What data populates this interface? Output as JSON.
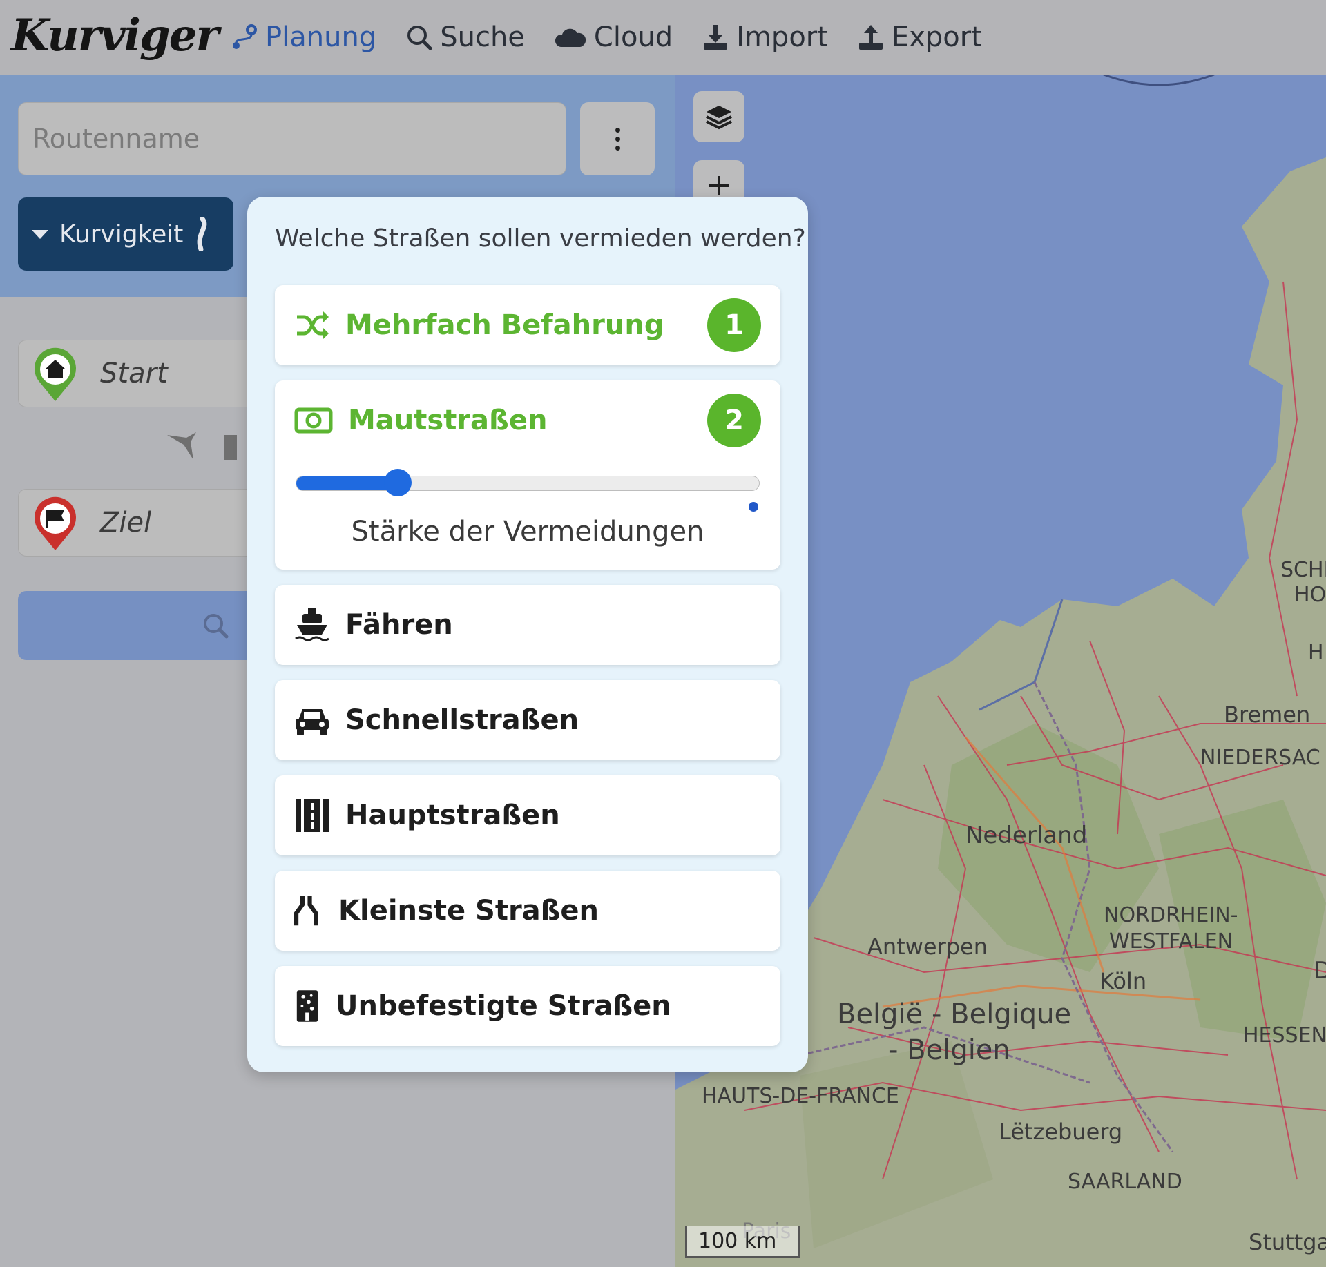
{
  "app": {
    "logo_text": "Kurviger"
  },
  "nav": {
    "items": [
      {
        "label": "Planung",
        "icon": "route-icon",
        "active": true
      },
      {
        "label": "Suche",
        "icon": "search-icon"
      },
      {
        "label": "Cloud",
        "icon": "cloud-icon"
      },
      {
        "label": "Import",
        "icon": "download-icon"
      },
      {
        "label": "Export",
        "icon": "upload-icon"
      }
    ]
  },
  "panel": {
    "routename_placeholder": "Routenname",
    "curviness_label": "Kurvigkeit",
    "start_placeholder": "Start",
    "destination_placeholder": "Ziel"
  },
  "avoid_popup": {
    "title": "Welche Straßen sollen vermieden werden?",
    "options": [
      {
        "label": "Mehrfach Befahrung",
        "icon": "shuffle-icon",
        "selected": true,
        "badge": "1"
      },
      {
        "label": "Mautstraßen",
        "icon": "money-bill-icon",
        "selected": true,
        "badge": "2",
        "strength_label": "Stärke der Vermeidungen",
        "strength_fraction": 0.22
      },
      {
        "label": "Fähren",
        "icon": "ferry-icon",
        "selected": false
      },
      {
        "label": "Schnellstraßen",
        "icon": "car-icon",
        "selected": false
      },
      {
        "label": "Hauptstraßen",
        "icon": "road-icon",
        "selected": false
      },
      {
        "label": "Kleinste Straßen",
        "icon": "narrow-road-icon",
        "selected": false
      },
      {
        "label": "Unbefestigte Straßen",
        "icon": "dirt-road-icon",
        "selected": false
      }
    ]
  },
  "map": {
    "scale_label": "100 km",
    "labels": [
      "SCHL",
      "HO",
      "H",
      "Bremen",
      "NIEDERSAC",
      "Nederland",
      "NORDRHEIN-",
      "WESTFALEN",
      "Antwerpen",
      "Köln",
      "D",
      "België - Belgique",
      "- Belgien",
      "HESSEN",
      "HAUTS-DE-FRANCE",
      "Lëtzebuerg",
      "SAARLAND",
      "Paris",
      "Stuttga"
    ]
  },
  "colors": {
    "accent_green": "#5ab52c",
    "nav_active": "#2c56a4",
    "slider_blue": "#1f6ae0",
    "dark_button": "#173d63"
  }
}
